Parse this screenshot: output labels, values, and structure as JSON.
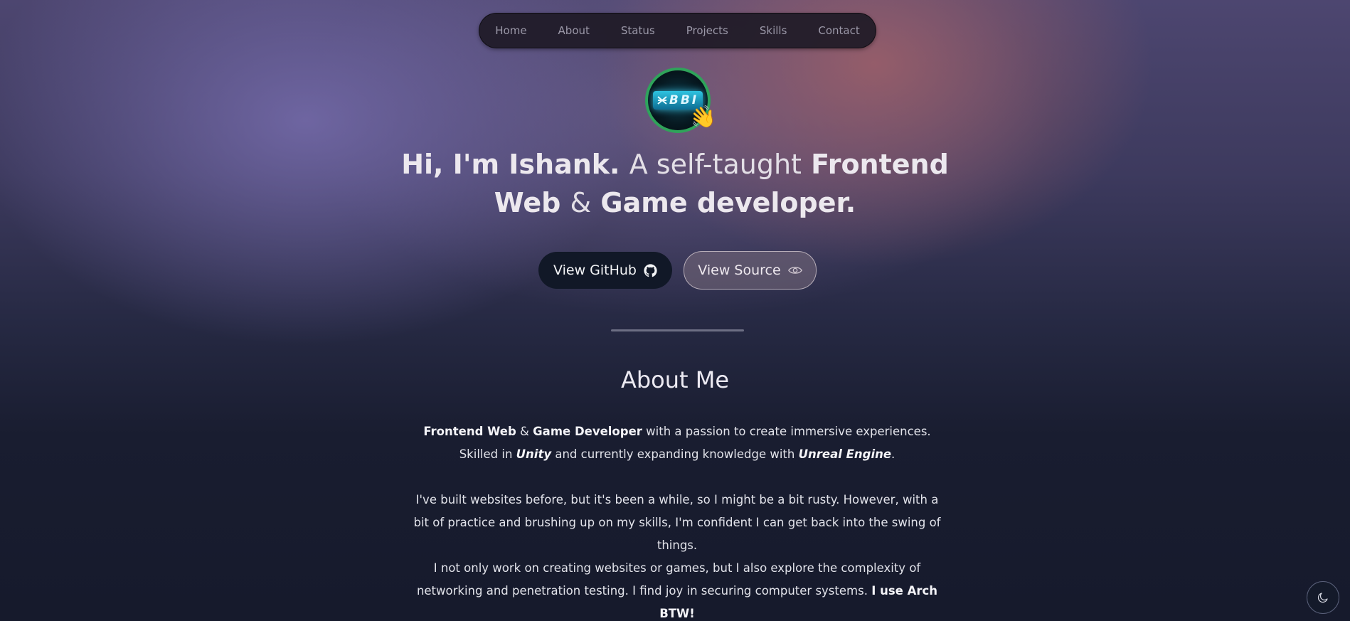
{
  "nav": {
    "items": [
      "Home",
      "About",
      "Status",
      "Projects",
      "Skills",
      "Contact"
    ]
  },
  "avatar": {
    "logo_text": "BBI",
    "emoji": "👋"
  },
  "hero": {
    "greeting": "Hi, I'm Ishank.",
    "tagline_plain": "A self-taught",
    "role_1": "Frontend Web",
    "amp": "&",
    "role_2": "Game developer."
  },
  "buttons": {
    "github_label": "View GitHub",
    "github_icon": "github-icon",
    "source_label": "View Source",
    "source_icon": "eye-icon"
  },
  "about": {
    "title": "About Me",
    "p1": {
      "role_1": "Frontend Web",
      "amp": "&",
      "role_2": "Game Developer",
      "text_1": "with a passion to create immersive experiences. Skilled in",
      "engine_1": "Unity",
      "text_2": "and currently expanding knowledge with",
      "engine_2": "Unreal Engine",
      "end": "."
    },
    "p2": "I've built websites before, but it's been a while, so I might be a bit rusty. However, with a bit of practice and brushing up on my skills, I'm confident I can get back into the swing of things.",
    "p3": {
      "text": "I not only work on creating websites or games, but I also explore the complexity of networking and penetration testing. I find joy in securing computer systems.",
      "bold": "I use Arch BTW!"
    }
  },
  "theme_toggle": {
    "icon": "moon-icon"
  },
  "colors": {
    "avatar_ring": "#2fa35a",
    "github_button_bg": "#111827",
    "page_bottom": "#161a2c"
  }
}
